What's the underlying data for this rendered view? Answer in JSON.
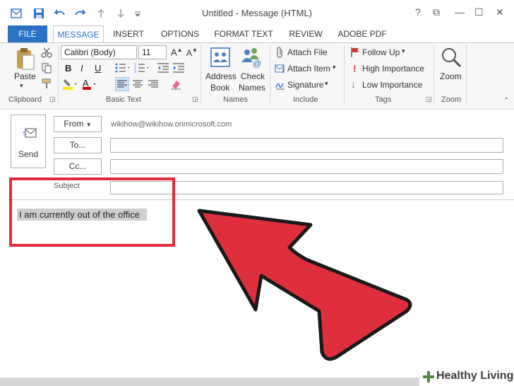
{
  "window": {
    "title": "Untitled - Message (HTML)",
    "help": "?",
    "restore": "⧉",
    "minimize": "—",
    "maximize": "☐",
    "close": "✕"
  },
  "tabs": {
    "file": "FILE",
    "message": "MESSAGE",
    "insert": "INSERT",
    "options": "OPTIONS",
    "format_text": "FORMAT TEXT",
    "review": "REVIEW",
    "adobe_pdf": "ADOBE PDF"
  },
  "ribbon": {
    "clipboard": {
      "paste": "Paste",
      "group": "Clipboard"
    },
    "basic_text": {
      "font": "Calibri (Body)",
      "size": "11",
      "group": "Basic Text"
    },
    "names": {
      "address_book_1": "Address",
      "address_book_2": "Book",
      "check_names_1": "Check",
      "check_names_2": "Names",
      "group": "Names"
    },
    "include": {
      "attach_file": "Attach File",
      "attach_item": "Attach Item",
      "signature": "Signature",
      "group": "Include"
    },
    "tags": {
      "follow_up": "Follow Up",
      "high_importance": "High Importance",
      "low_importance": "Low Importance",
      "group": "Tags"
    },
    "zoom": {
      "zoom": "Zoom",
      "group": "Zoom"
    }
  },
  "compose": {
    "send": "Send",
    "from_label": "From",
    "from_value": "wikihow@wikihow.onmicrosoft.com",
    "to_label": "To...",
    "cc_label": "Cc...",
    "subject_label": "Subject",
    "body_text": "I am currently out of the office"
  },
  "watermark": {
    "brand": "Healthy Living"
  },
  "colors": {
    "accent": "#2b72c4",
    "highlight_box": "#e12d3a",
    "arrow_fill": "#e0303c"
  }
}
